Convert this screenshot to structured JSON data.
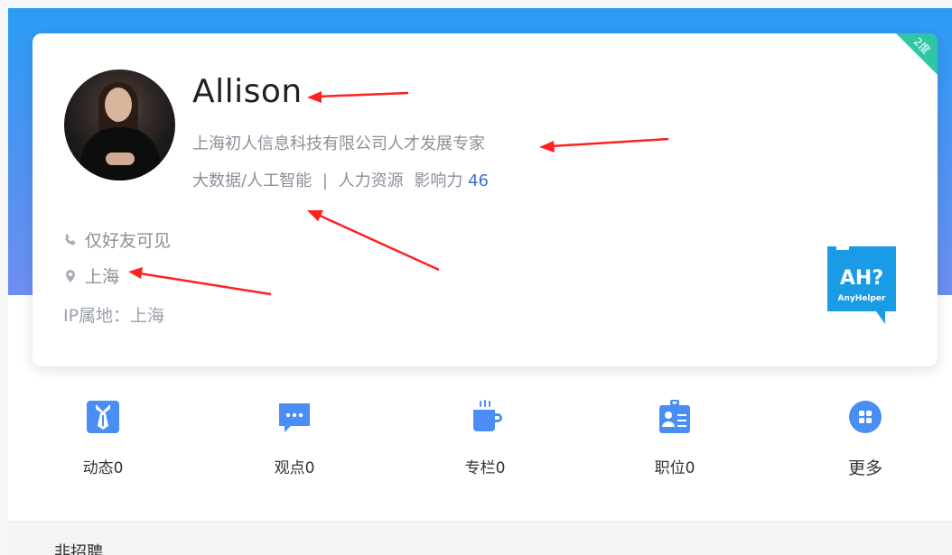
{
  "profile": {
    "badge": "2度",
    "name": "Allison",
    "title": "上海初人信息科技有限公司人才发展专家",
    "industry": "大数据/人工智能",
    "separator": "|",
    "category": "人力资源",
    "influence_label": "影响力",
    "influence_value": "46",
    "contact": "仅好友可见",
    "location": "上海",
    "ip_location": "IP属地：上海"
  },
  "logo": {
    "mark": "AH?",
    "text": "AnyHelper",
    "color": "#1a9be6"
  },
  "nav": {
    "items": [
      {
        "label": "动态0",
        "icon": "tie-icon"
      },
      {
        "label": "观点0",
        "icon": "chat-bubble-icon"
      },
      {
        "label": "专栏0",
        "icon": "coffee-cup-icon"
      },
      {
        "label": "职位0",
        "icon": "id-badge-icon"
      },
      {
        "label": "更多",
        "icon": "grid-dots-icon"
      }
    ]
  },
  "footer": {
    "partial_text": "非招聘"
  },
  "colors": {
    "accent": "#2a9cf4",
    "icon_blue": "#4a8ef5",
    "badge_green": "#2ec7a6",
    "annotation_red": "#ff2020"
  }
}
